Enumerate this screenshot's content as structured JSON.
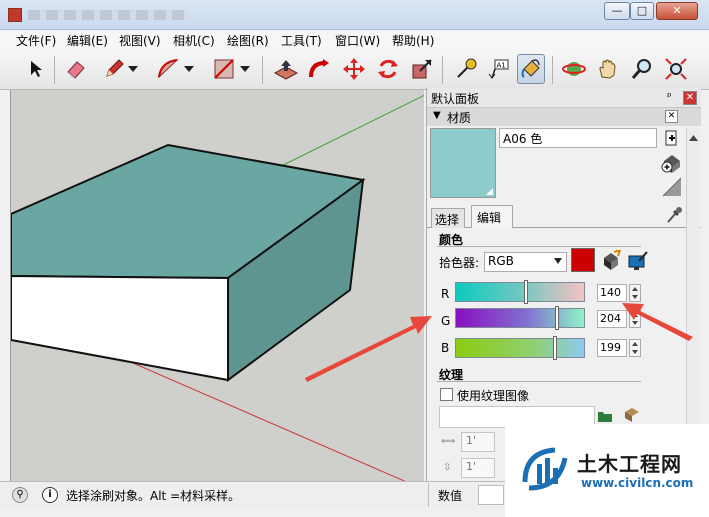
{
  "window": {
    "minimize": "—",
    "maximize": "□",
    "close": "✕"
  },
  "menu": [
    "文件(F)",
    "编辑(E)",
    "视图(V)",
    "相机(C)",
    "绘图(R)",
    "工具(T)",
    "窗口(W)",
    "帮助(H)"
  ],
  "toolbar": {
    "icons": [
      "select-arrow-icon",
      "eraser-icon",
      "pencil-icon",
      "arc-icon",
      "rectangle-icon",
      "push-pull-icon",
      "follow-me-icon",
      "move-icon",
      "rotate-icon",
      "scale-icon",
      "tape-measure-icon",
      "text-icon",
      "paint-bucket-icon",
      "orbit-icon",
      "pan-hand-icon",
      "zoom-icon",
      "zoom-extents-icon"
    ]
  },
  "panel": {
    "title": "默认面板",
    "pin": "ᵖ",
    "close": "✕",
    "section": "材质",
    "material_name": "A06 色",
    "material_color": "#8ccccc",
    "tabs": [
      "选择",
      "编辑"
    ],
    "active_tab": 1,
    "color_heading": "颜色",
    "picker_label": "拾色器:",
    "picker_value": "RGB",
    "swatch_color": "#cc0000",
    "channels": [
      {
        "label": "R",
        "value": "140",
        "level": 0.55
      },
      {
        "label": "G",
        "value": "204",
        "level": 0.8
      },
      {
        "label": "B",
        "value": "199",
        "level": 0.78
      }
    ],
    "texture_heading": "纹理",
    "use_texture_label": "使用纹理图像",
    "width_value": "1'",
    "height_value": "1'"
  },
  "status": {
    "message": "选择涂刷对象。Alt =材料采样。",
    "measure_label": "数值"
  },
  "watermark": {
    "brand": "土木工程网",
    "url": "www.civilcn.com"
  },
  "colors": {
    "box_top": "#6aa7a2",
    "box_side": "#5f9591",
    "box_front": "#ffffff",
    "arrow": "#e8483b"
  }
}
